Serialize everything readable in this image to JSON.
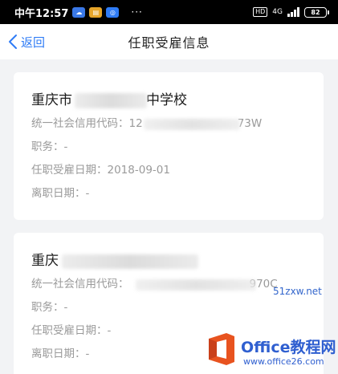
{
  "status_bar": {
    "time": "中午12:57",
    "network": "4G",
    "battery": "82",
    "hd": "HD",
    "dots": "···"
  },
  "nav": {
    "back_label": "返回",
    "title": "任职受雇信息"
  },
  "records": [
    {
      "company_visible_start": "重庆市",
      "company_visible_end": "中学校",
      "credit_label": "统一社会信用代码：",
      "credit_code_visible_start": "12",
      "credit_code_visible_end": "73W",
      "position_label": "职务：",
      "position_value": "-",
      "hire_date_label": "任职受雇日期：",
      "hire_date_value": "2018-09-01",
      "leave_date_label": "离职日期：",
      "leave_date_value": "-"
    },
    {
      "company_visible_start": "重庆",
      "company_visible_end": "",
      "credit_label": "统一社会信用代码：",
      "credit_code_visible_start": "",
      "credit_code_visible_end": "970C",
      "position_label": "职务：",
      "position_value": "-",
      "hire_date_label": "任职受雇日期：",
      "hire_date_value": "-",
      "leave_date_label": "离职日期：",
      "leave_date_value": "-"
    }
  ],
  "watermark": {
    "url": "51zxw.net",
    "brand": "Office教程网",
    "site": "www.office26.com"
  },
  "colors": {
    "accent": "#2f7cf6",
    "background": "#f2f3f5",
    "card": "#ffffff",
    "label": "#9a9a9a",
    "title": "#1a1a1a"
  }
}
